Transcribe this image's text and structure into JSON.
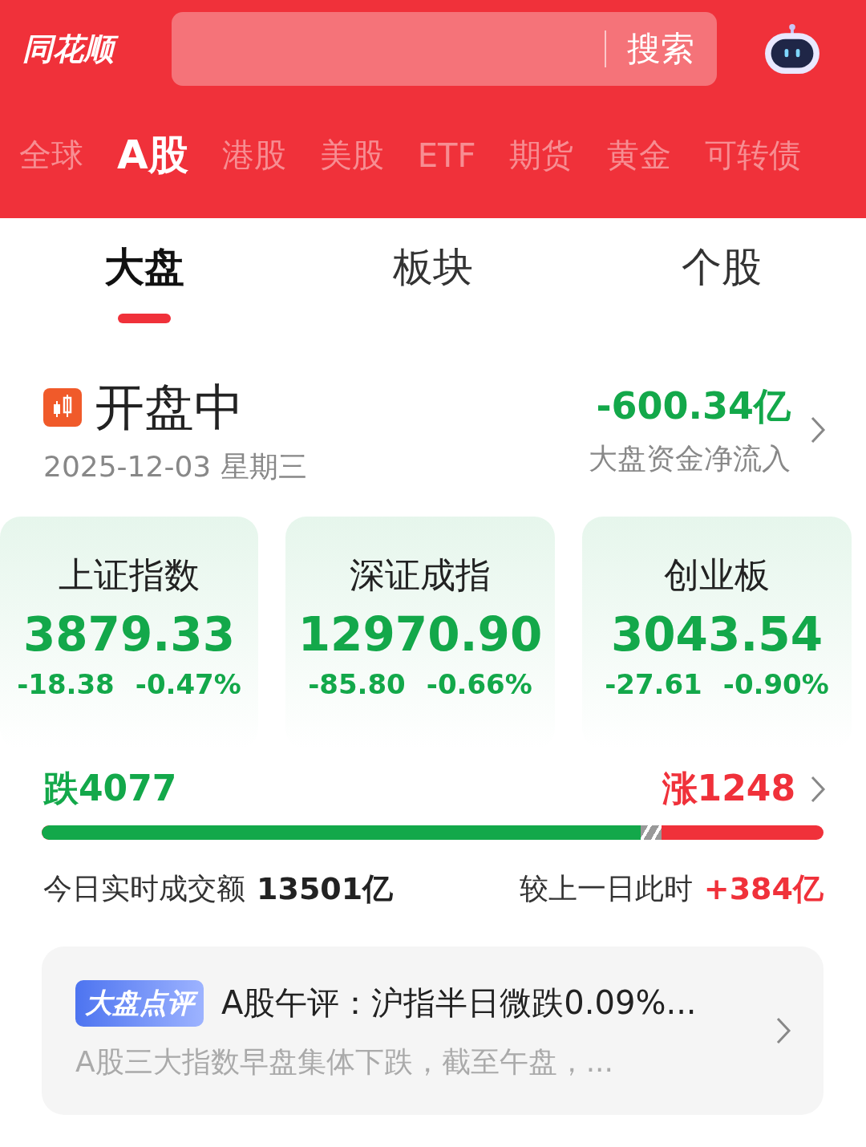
{
  "header": {
    "logo": "同花顺",
    "search_button": "搜索"
  },
  "market_tabs": [
    {
      "label": "全球",
      "selected": false
    },
    {
      "label": "A股",
      "selected": true
    },
    {
      "label": "港股",
      "selected": false
    },
    {
      "label": "美股",
      "selected": false
    },
    {
      "label": "ETF",
      "selected": false
    },
    {
      "label": "期货",
      "selected": false
    },
    {
      "label": "黄金",
      "selected": false
    },
    {
      "label": "可转债",
      "selected": false
    }
  ],
  "sub_tabs": [
    {
      "label": "大盘",
      "selected": true
    },
    {
      "label": "板块",
      "selected": false
    },
    {
      "label": "个股",
      "selected": false
    }
  ],
  "status": {
    "title": "开盘中",
    "date": "2025-12-03 星期三",
    "net_flow": "-600.34亿",
    "net_flow_label": "大盘资金净流入"
  },
  "indices": [
    {
      "name": "上证指数",
      "value": "3879.33",
      "change": "-18.38",
      "percent": "-0.47%"
    },
    {
      "name": "深证成指",
      "value": "12970.90",
      "change": "-85.80",
      "percent": "-0.66%"
    },
    {
      "name": "创业板",
      "value": "3043.54",
      "change": "-27.61",
      "percent": "-0.90%"
    }
  ],
  "breadth": {
    "down": "跌4077",
    "up": "涨1248",
    "level": 0.766
  },
  "turnover": {
    "label": "今日实时成交额",
    "value": "13501亿",
    "compare_label": "较上一日此时",
    "compare_value": "+384亿"
  },
  "news": {
    "tag": "大盘点评",
    "title": "A股午评：沪指半日微跌0.09%...",
    "summary": "A股三大指数早盘集体下跌，截至午盘，..."
  }
}
